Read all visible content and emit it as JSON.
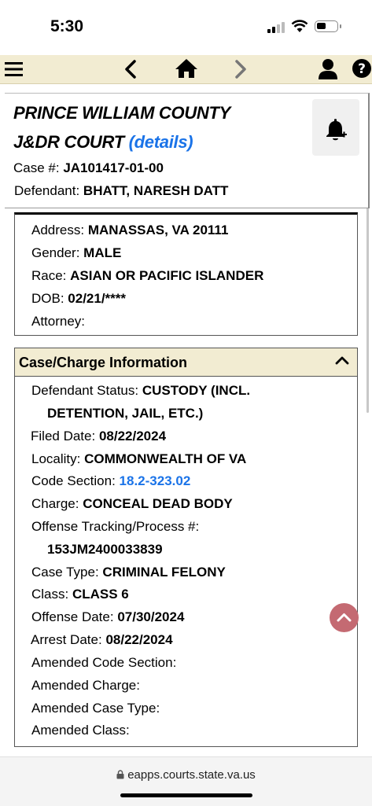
{
  "status_bar": {
    "time": "5:30"
  },
  "header": {
    "court_line1": "PRINCE WILLIAM COUNTY",
    "court_line2": "J&DR COURT",
    "details_link": "(details)",
    "case_label": "Case #:",
    "case_value": "JA101417-01-00",
    "defendant_label": "Defendant:",
    "defendant_value": "BHATT, NARESH DATT"
  },
  "defendant_info": {
    "address_label": "Address:",
    "address_value": "MANASSAS, VA 20111",
    "gender_label": "Gender:",
    "gender_value": "MALE",
    "race_label": "Race:",
    "race_value": "ASIAN OR PACIFIC ISLANDER",
    "dob_label": "DOB:",
    "dob_value": "02/21/****",
    "attorney_label": "Attorney:",
    "attorney_value": ""
  },
  "case_charge": {
    "title": "Case/Charge Information",
    "status_label": "Defendant Status:",
    "status_value_1": "CUSTODY (INCL.",
    "status_value_2": "DETENTION, JAIL, ETC.)",
    "filed_label": "Filed Date:",
    "filed_value": "08/22/2024",
    "locality_label": "Locality:",
    "locality_value": "COMMONWEALTH OF VA",
    "code_label": "Code Section:",
    "code_value": "18.2-323.02",
    "charge_label": "Charge:",
    "charge_value": "CONCEAL DEAD BODY",
    "otn_label": "Offense Tracking/Process #:",
    "otn_value": "153JM2400033839",
    "case_type_label": "Case Type:",
    "case_type_value": "CRIMINAL FELONY",
    "class_label": "Class:",
    "class_value": "CLASS 6",
    "offense_date_label": "Offense Date:",
    "offense_date_value": "07/30/2024",
    "arrest_date_label": "Arrest Date:",
    "arrest_date_value": "08/22/2024",
    "amended_code_label": "Amended Code Section:",
    "amended_charge_label": "Amended Charge:",
    "amended_case_type_label": "Amended Case Type:",
    "amended_class_label": "Amended Class:"
  },
  "browser": {
    "url": "eapps.courts.state.va.us"
  },
  "colors": {
    "accent": "#f2ecd2",
    "link": "#1a73e8",
    "scroll_button": "#c46a72"
  },
  "icons": [
    "menu-icon",
    "back-icon",
    "home-icon",
    "forward-icon",
    "user-icon",
    "help-icon",
    "bell-plus-icon",
    "chevron-up-icon",
    "lock-icon"
  ]
}
